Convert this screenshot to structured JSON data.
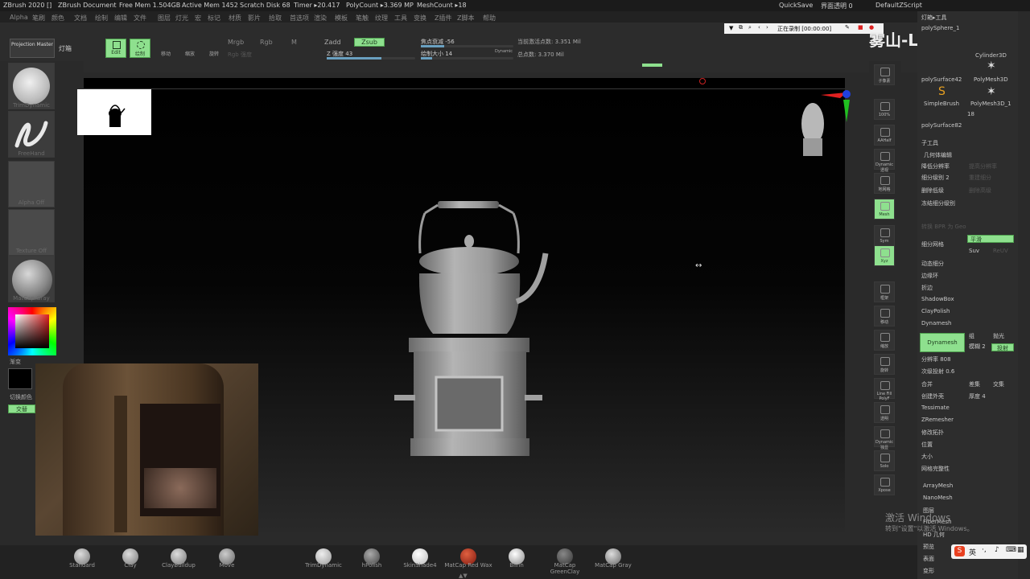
{
  "titlebar": {
    "app": "ZBrush 2020 []",
    "document": "ZBrush Document",
    "free_mem": "Free Mem 1.504GB",
    "active_mem": "Active Mem 1452",
    "scratch": "Scratch Disk 68",
    "timer": "Timer ▸20.417",
    "polycount": "PolyCount ▸3.369 MP",
    "meshcount": "MeshCount ▸18",
    "quicksave": "QuickSave",
    "transparency": "界面透明 0",
    "script": "DefaultZScript"
  },
  "menu": [
    "Alpha",
    "笔刷",
    "颜色",
    "文档",
    "绘制",
    "编辑",
    "文件",
    "图层",
    "灯光",
    "宏",
    "标记",
    "材质",
    "影片",
    "拾取",
    "首选项",
    "渲染",
    "模板",
    "笔触",
    "纹理",
    "工具",
    "变换",
    "Z插件",
    "Z脚本",
    "帮助"
  ],
  "toolbar": {
    "projection": "Projection Master",
    "lightbox": "灯箱",
    "edit": "Edit",
    "draw": "绘制",
    "move": "移动",
    "scale": "缩放",
    "rotate": "旋转",
    "mrgb": "Mrgb",
    "rgb": "Rgb",
    "m": "M",
    "rgb_intensity": "Rgb 强度",
    "zadd": "Zadd",
    "zsub": "Zsub",
    "z_intensity": "Z 强度 43",
    "focal_shift": "焦点衰减 -56",
    "draw_size": "绘制大小 14",
    "dynamic": "Dynamic",
    "active_points": "当前激活点数: 3.351 Mil",
    "total_points": "总点数: 3.370 Mil"
  },
  "left": {
    "brush": "TrimDynamic",
    "stroke": "FreeHand",
    "alpha": "Alpha Off",
    "texture": "Texture Off",
    "material": "MatCap Gray",
    "gradient": "渐变",
    "switch_color": "切换颜色",
    "alternate": "交替"
  },
  "recording": "正在录制 [00:00:00]",
  "watermark": "雾山-Lee",
  "right_icons": [
    "子像素",
    "100%",
    "AAHalf",
    "Dynamic 透视",
    "地网格",
    "Mesh",
    "Sym",
    "Xyz",
    "框架",
    "移动",
    "缩放",
    "旋转",
    "Line Fill PolyF",
    "透明",
    "Dynamic 独显",
    "Solo",
    "Xpose"
  ],
  "tools": {
    "header": "灯箱▸工具",
    "items": [
      "polySphere_1",
      "Cylinder3D",
      "polySurface42",
      "PolyMesh3D",
      "SimpleBrush",
      "PolyMesh3D_1",
      "polySurface82"
    ],
    "count": "18",
    "subtool": "子工具",
    "geometry": "几何体编辑",
    "lower_res": "降低分辨率",
    "higher_res": "提高分辨率",
    "sdiv": "细分级别 2",
    "reconstruct": "重建细分",
    "del_lower": "删除低级",
    "del_higher": "删除高级",
    "freeze": "冻结细分级别",
    "convert": "转换 BPR 为 Geo",
    "divide": "细分网格",
    "smooth": "平滑",
    "suv": "Suv",
    "reuv": "ReUV",
    "dynamic_subdiv": "动态细分",
    "edge_loop": "边缘环",
    "crease": "折边",
    "shadowbox": "ShadowBox",
    "claypolish": "ClayPolish",
    "dynamesh_section": "Dynamesh",
    "dynamesh": "Dynamesh",
    "group": "组",
    "polish": "抛光",
    "blur": "模糊 2",
    "project": "投射",
    "resolution": "分辨率 808",
    "subproject": "次级投射 0.6",
    "merge": "合并",
    "subtract": "差集",
    "intersect": "交集",
    "create_shell": "创建外壳",
    "thickness": "厚度 4",
    "tessimate": "Tessimate",
    "zremesher": "ZRemesher",
    "modify_topology": "修改拓扑",
    "position": "位置",
    "size": "大小",
    "mesh_integrity": "网格完整性",
    "arraymesh": "ArrayMesh",
    "nanomesh": "NanoMesh",
    "layers": "图层",
    "fibermesh": "FiberMesh",
    "hd_geometry": "HD 几何",
    "preview": "预览",
    "surface": "表面",
    "deformation": "变形"
  },
  "activate": {
    "line1": "激活 Windows",
    "line2": "转到\"设置\"以激活 Windows。"
  },
  "ime": "英",
  "bottom_shelf": [
    "Standard",
    "Clay",
    "ClayBuildup",
    "Move",
    "TrimDynamic",
    "hPolish",
    "SkinShade4",
    "MatCap Red Wax",
    "Blinn",
    "MatCap GreenClay",
    "MatCap Gray"
  ]
}
